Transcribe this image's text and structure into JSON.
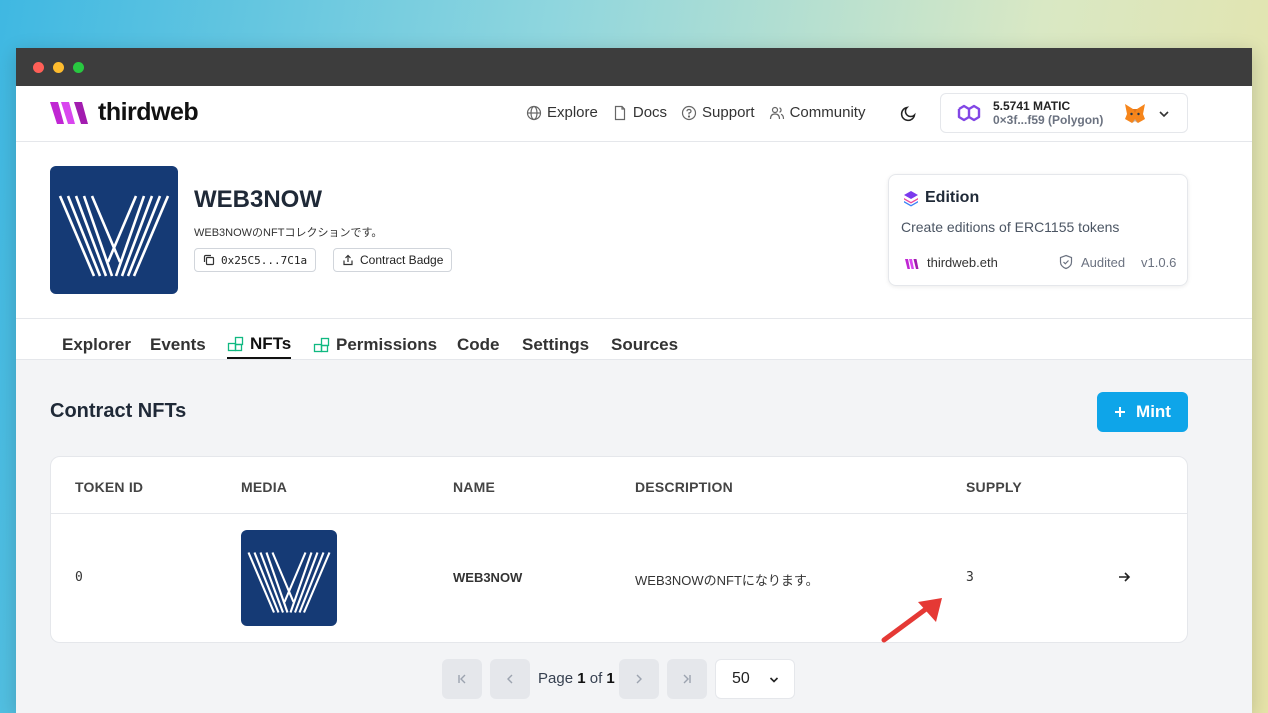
{
  "topnav": {
    "brand": "thirdweb",
    "links": [
      {
        "label": "Explore",
        "icon": "globe-icon"
      },
      {
        "label": "Docs",
        "icon": "document-icon"
      },
      {
        "label": "Support",
        "icon": "help-circle-icon"
      },
      {
        "label": "Community",
        "icon": "users-icon"
      }
    ],
    "wallet": {
      "balance": "5.5741 MATIC",
      "address": "0×3f...f59 (Polygon)"
    }
  },
  "contract": {
    "title": "WEB3NOW",
    "description": "WEB3NOWのNFTコレクションです。",
    "address": "0x25C5...7C1a",
    "badge_label": "Contract Badge"
  },
  "edition_card": {
    "title": "Edition",
    "description": "Create editions of ERC1155 tokens",
    "author": "thirdweb.eth",
    "audited": "Audited",
    "version": "v1.0.6"
  },
  "tabs": [
    {
      "label": "Explorer"
    },
    {
      "label": "Events"
    },
    {
      "label": "NFTs",
      "active": true
    },
    {
      "label": "Permissions"
    },
    {
      "label": "Code"
    },
    {
      "label": "Settings"
    },
    {
      "label": "Sources"
    }
  ],
  "main": {
    "section_title": "Contract NFTs",
    "mint_label": "Mint"
  },
  "table": {
    "headers": [
      "TOKEN ID",
      "MEDIA",
      "NAME",
      "DESCRIPTION",
      "SUPPLY"
    ],
    "rows": [
      {
        "token_id": "0",
        "name": "WEB3NOW",
        "description": "WEB3NOWのNFTになります。",
        "supply": "3"
      }
    ]
  },
  "pagination": {
    "page_prefix": "Page",
    "current": "1",
    "of_label": "of",
    "total": "1",
    "page_size": "50"
  },
  "colors": {
    "accent": "#0ea5e9",
    "brand_logo": "#c026d3",
    "nft_image_bg": "#153a75",
    "annotation_arrow": "#e53935"
  }
}
